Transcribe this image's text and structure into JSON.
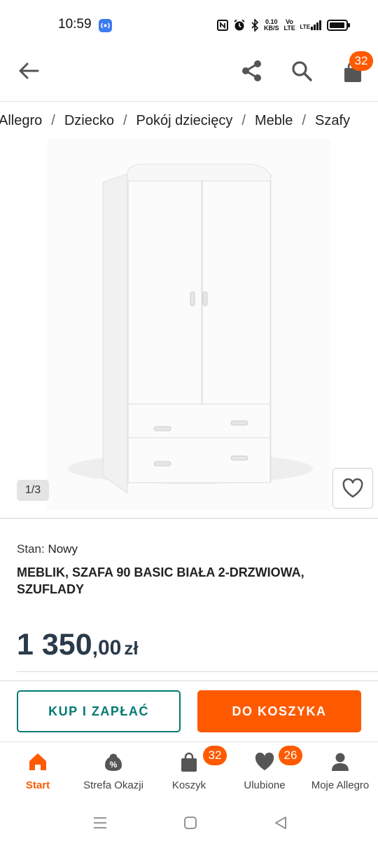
{
  "status_bar": {
    "time": "10:59",
    "speed_value": "0.10",
    "speed_unit": "KB/S",
    "net1": "Vo LTE",
    "net2": "LTE",
    "icons": [
      "nfc-icon",
      "alarm-icon",
      "bluetooth-icon",
      "signal-icon",
      "battery-icon"
    ]
  },
  "app_bar": {
    "cart_count": "32",
    "icons": [
      "back-arrow-icon",
      "share-icon",
      "search-icon",
      "cart-icon"
    ]
  },
  "breadcrumb": [
    "Allegro",
    "Dziecko",
    "Pokój dziecięcy",
    "Meble",
    "Szafy"
  ],
  "breadcrumb_separator": "/",
  "gallery": {
    "counter": "1/3",
    "favorite_icon": "heart-outline-icon"
  },
  "product": {
    "condition_label": "Stan:",
    "condition_value": "Nowy",
    "title": "MEBLIK, SZAFA 90 BASIC BIAŁA 2-DRZWIOWA, SZUFLADY",
    "price_int": "1 350",
    "price_dec": ",00",
    "currency": "zł"
  },
  "actions": {
    "buy_label": "KUP I ZAPŁAĆ",
    "cart_label": "DO KOSZYKA"
  },
  "bottom_nav": [
    {
      "label": "Start",
      "icon": "home-icon",
      "active": true
    },
    {
      "label": "Strefa Okazji",
      "icon": "percent-bag-icon"
    },
    {
      "label": "Koszyk",
      "icon": "cart-icon",
      "badge": "32"
    },
    {
      "label": "Ulubione",
      "icon": "heart-icon",
      "badge": "26"
    },
    {
      "label": "Moje Allegro",
      "icon": "user-icon"
    }
  ],
  "colors": {
    "accent": "#ff5a00",
    "teal": "#007a72"
  }
}
